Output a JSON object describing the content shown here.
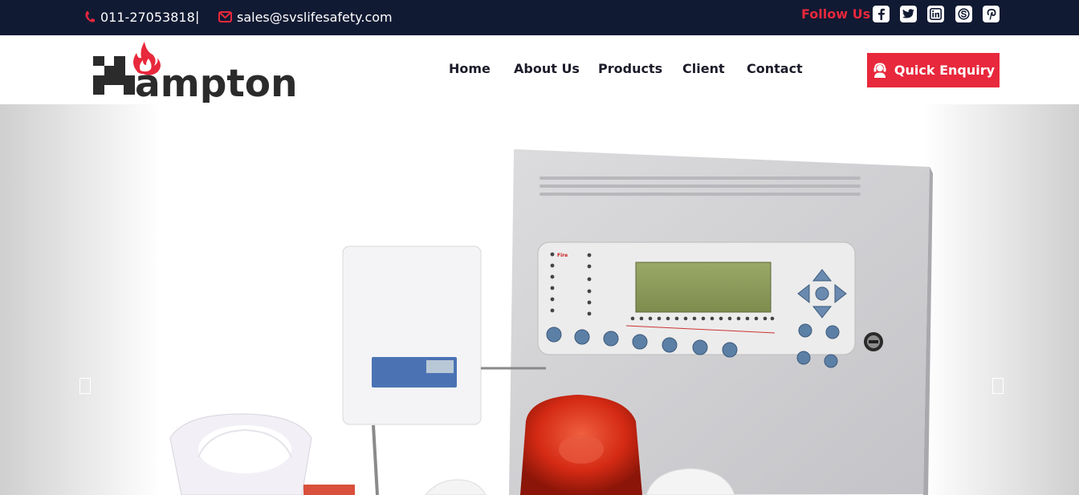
{
  "topbar": {
    "phone": "011-27053818",
    "separator": "|",
    "email": "sales@svslifesafety.com",
    "follow_label": "Follow Us",
    "social": [
      "facebook-icon",
      "twitter-icon",
      "linkedin-icon",
      "skype-icon",
      "pinterest-icon"
    ]
  },
  "header": {
    "logo_text": "ampton",
    "logo_letter": "H",
    "nav": [
      "Home",
      "About Us",
      "Products",
      "Client",
      "Contact"
    ],
    "enquiry_label": "Quick Enquiry"
  },
  "hero": {
    "panel_label_fire": "Fire",
    "prev_icon": "chevron-left-icon",
    "next_icon": "chevron-right-icon"
  },
  "colors": {
    "topbar_bg": "#111a33",
    "accent": "#e8283c",
    "nav_text": "#1c1c2a"
  }
}
